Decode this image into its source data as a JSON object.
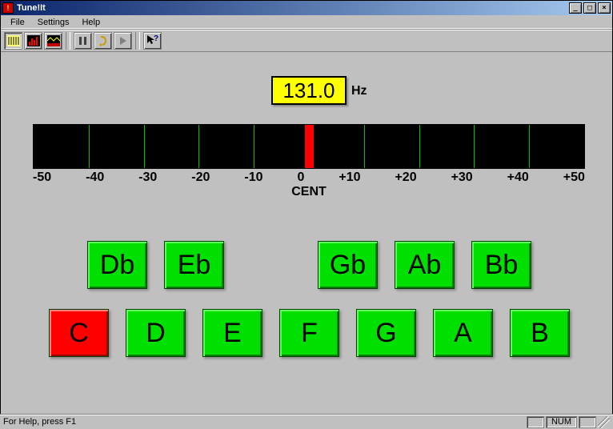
{
  "window": {
    "title": "Tune!It"
  },
  "menu": {
    "file": "File",
    "settings": "Settings",
    "help": "Help"
  },
  "toolbar": {
    "icons": [
      "meter-icon",
      "spectrum-icon",
      "waveform-icon",
      "pause-icon",
      "ear-icon",
      "play-icon",
      "help-cursor-icon"
    ]
  },
  "frequency": {
    "value": "131.0",
    "unit": "Hz"
  },
  "meter": {
    "labels": [
      "-50",
      "-40",
      "-30",
      "-20",
      "-10",
      "0",
      "+10",
      "+20",
      "+30",
      "+40",
      "+50"
    ],
    "caption": "CENT",
    "needle_pos": 0
  },
  "notes": {
    "sharps": [
      {
        "label": "Db",
        "col": 0
      },
      {
        "label": "Eb",
        "col": 1
      },
      {
        "label": "Gb",
        "col": 3
      },
      {
        "label": "Ab",
        "col": 4
      },
      {
        "label": "Bb",
        "col": 5
      }
    ],
    "naturals": [
      {
        "label": "C",
        "active": true
      },
      {
        "label": "D",
        "active": false
      },
      {
        "label": "E",
        "active": false
      },
      {
        "label": "F",
        "active": false
      },
      {
        "label": "G",
        "active": false
      },
      {
        "label": "A",
        "active": false
      },
      {
        "label": "B",
        "active": false
      }
    ]
  },
  "status": {
    "text": "For Help, press F1",
    "num": "NUM"
  },
  "colors": {
    "accent_active_note": "#ff0000",
    "note_green": "#00e000",
    "freq_bg": "#ffff00"
  }
}
